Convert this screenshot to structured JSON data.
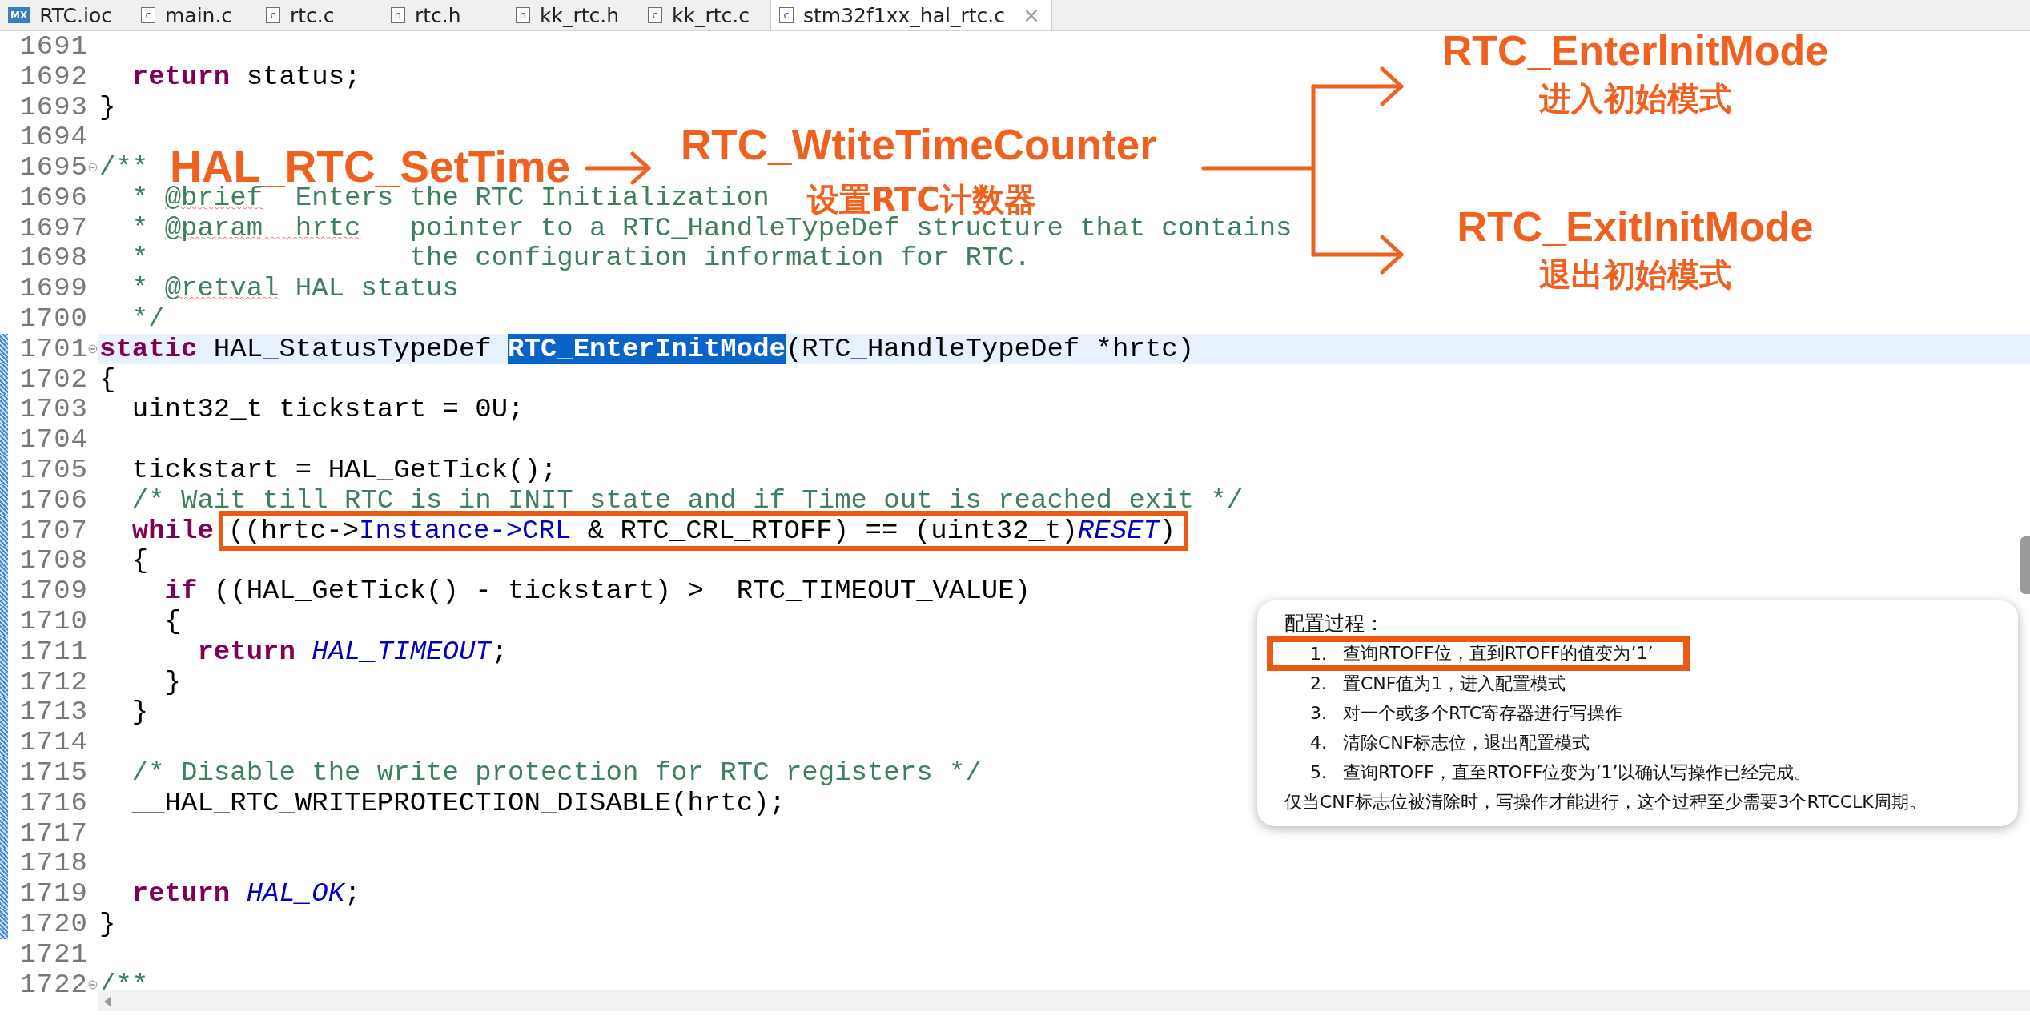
{
  "tabs": [
    {
      "label": "RTC.ioc",
      "icon": "MX",
      "kind": "mx",
      "selected": false
    },
    {
      "label": "main.c",
      "icon": "c",
      "kind": "file",
      "selected": false
    },
    {
      "label": "rtc.c",
      "icon": "c",
      "kind": "file",
      "selected": false
    },
    {
      "label": "rtc.h",
      "icon": "h",
      "kind": "file",
      "selected": false
    },
    {
      "label": "kk_rtc.h",
      "icon": "h",
      "kind": "file",
      "selected": false
    },
    {
      "label": "kk_rtc.c",
      "icon": "c",
      "kind": "file",
      "selected": false
    },
    {
      "label": "stm32f1xx_hal_rtc.c",
      "icon": "c",
      "kind": "file",
      "selected": true,
      "close": "×"
    }
  ],
  "lines": [
    {
      "number": "1691",
      "fold": false,
      "current": false,
      "changed": false
    },
    {
      "number": "1692",
      "fold": false,
      "current": false,
      "changed": false,
      "segments": [
        {
          "text": "  return",
          "kind": "keyword"
        },
        {
          "text": " status;",
          "kind": "plain"
        }
      ]
    },
    {
      "number": "1693",
      "fold": false,
      "current": false,
      "changed": false,
      "segments": [
        {
          "text": "}",
          "kind": "plain"
        }
      ]
    },
    {
      "number": "1694",
      "fold": false,
      "current": false,
      "changed": false
    },
    {
      "number": "1695",
      "fold": true,
      "current": false,
      "changed": false,
      "segments": [
        {
          "text": "/**",
          "kind": "comment"
        }
      ]
    },
    {
      "number": "1696",
      "fold": false,
      "current": false,
      "changed": false,
      "segments": [
        {
          "text": "  * ",
          "kind": "comment"
        },
        {
          "text": "@brief",
          "kind": "spelling"
        },
        {
          "text": "  Enters the RTC Initialization",
          "kind": "comment"
        }
      ]
    },
    {
      "number": "1697",
      "fold": false,
      "current": false,
      "changed": false,
      "segments": [
        {
          "text": "  * ",
          "kind": "comment"
        },
        {
          "text": "@param",
          "kind": "spelling"
        },
        {
          "text": "  hrtc",
          "kind": "spelling"
        },
        {
          "text": "   pointer to a RTC_HandleTypeDef structure that contains",
          "kind": "comment"
        }
      ]
    },
    {
      "number": "1698",
      "fold": false,
      "current": false,
      "changed": false,
      "segments": [
        {
          "text": "  *                the configuration information for RTC.",
          "kind": "comment"
        }
      ]
    },
    {
      "number": "1699",
      "fold": false,
      "current": false,
      "changed": false,
      "segments": [
        {
          "text": "  * ",
          "kind": "comment"
        },
        {
          "text": "@retval",
          "kind": "spelling"
        },
        {
          "text": " HAL status",
          "kind": "comment"
        }
      ]
    },
    {
      "number": "1700",
      "fold": false,
      "current": false,
      "changed": false,
      "segments": [
        {
          "text": "  */",
          "kind": "comment"
        }
      ]
    },
    {
      "number": "1701",
      "fold": true,
      "current": true,
      "changed": true,
      "segments": [
        {
          "text": "static",
          "kind": "keyword"
        },
        {
          "text": " HAL_StatusTypeDef ",
          "kind": "plain"
        },
        {
          "text": "RTC_EnterInitMode",
          "kind": "selected"
        },
        {
          "text": "(RTC_HandleTypeDef *hrtc)",
          "kind": "plain"
        }
      ]
    },
    {
      "number": "1702",
      "fold": false,
      "current": false,
      "changed": true,
      "segments": [
        {
          "text": "{",
          "kind": "plain"
        }
      ]
    },
    {
      "number": "1703",
      "fold": false,
      "current": false,
      "changed": true,
      "segments": [
        {
          "text": "  uint32_t tickstart = 0U;",
          "kind": "plain"
        }
      ]
    },
    {
      "number": "1704",
      "fold": false,
      "current": false,
      "changed": true
    },
    {
      "number": "1705",
      "fold": false,
      "current": false,
      "changed": true,
      "segments": [
        {
          "text": "  tickstart = HAL_GetTick();",
          "kind": "plain"
        }
      ]
    },
    {
      "number": "1706",
      "fold": false,
      "current": false,
      "changed": true,
      "segments": [
        {
          "text": "  /* Wait till RTC is in INIT state and if Time out is reached exit */",
          "kind": "comment"
        }
      ]
    },
    {
      "number": "1707",
      "fold": false,
      "current": false,
      "changed": true,
      "segments": [
        {
          "text": "  while",
          "kind": "keyword"
        }
      ],
      "outlined_segments": [
        {
          "text": "((hrtc->",
          "kind": "plain"
        },
        {
          "text": "Instance->CRL",
          "kind": "field"
        },
        {
          "text": " & RTC_CRL_RTOFF) == (uint32_t)",
          "kind": "plain"
        },
        {
          "text": "RESET",
          "kind": "constant"
        },
        {
          "text": ")",
          "kind": "plain"
        }
      ]
    },
    {
      "number": "1708",
      "fold": false,
      "current": false,
      "changed": true,
      "segments": [
        {
          "text": "  {",
          "kind": "plain"
        }
      ]
    },
    {
      "number": "1709",
      "fold": false,
      "current": false,
      "changed": true,
      "segments": [
        {
          "text": "    if",
          "kind": "keyword"
        },
        {
          "text": " ((HAL_GetTick() - tickstart) >  RTC_TIMEOUT_VALUE)",
          "kind": "plain"
        }
      ]
    },
    {
      "number": "1710",
      "fold": false,
      "current": false,
      "changed": true,
      "segments": [
        {
          "text": "    {",
          "kind": "plain"
        }
      ]
    },
    {
      "number": "1711",
      "fold": false,
      "current": false,
      "changed": true,
      "segments": [
        {
          "text": "      return",
          "kind": "keyword"
        },
        {
          "text": " HAL_TIMEOUT",
          "kind": "constant"
        },
        {
          "text": ";",
          "kind": "plain"
        }
      ]
    },
    {
      "number": "1712",
      "fold": false,
      "current": false,
      "changed": true,
      "segments": [
        {
          "text": "    }",
          "kind": "plain"
        }
      ]
    },
    {
      "number": "1713",
      "fold": false,
      "current": false,
      "changed": true,
      "segments": [
        {
          "text": "  }",
          "kind": "plain"
        }
      ]
    },
    {
      "number": "1714",
      "fold": false,
      "current": false,
      "changed": true
    },
    {
      "number": "1715",
      "fold": false,
      "current": false,
      "changed": true,
      "segments": [
        {
          "text": "  /* Disable the write protection for RTC registers */",
          "kind": "comment"
        }
      ]
    },
    {
      "number": "1716",
      "fold": false,
      "current": false,
      "changed": true,
      "segments": [
        {
          "text": "  __HAL_RTC_WRITEPROTECTION_DISABLE(hrtc);",
          "kind": "plain"
        }
      ]
    },
    {
      "number": "1717",
      "fold": false,
      "current": false,
      "changed": true
    },
    {
      "number": "1718",
      "fold": false,
      "current": false,
      "changed": true
    },
    {
      "number": "1719",
      "fold": false,
      "current": false,
      "changed": true,
      "segments": [
        {
          "text": "  return",
          "kind": "keyword"
        },
        {
          "text": " HAL_OK",
          "kind": "constant"
        },
        {
          "text": ";",
          "kind": "plain"
        }
      ]
    },
    {
      "number": "1720",
      "fold": false,
      "current": false,
      "changed": true,
      "segments": [
        {
          "text": "}",
          "kind": "plain"
        }
      ]
    },
    {
      "number": "1721",
      "fold": false,
      "current": false,
      "changed": false
    },
    {
      "number": "1722",
      "fold": true,
      "current": false,
      "changed": false,
      "segments": [
        {
          "text": "/**",
          "kind": "comment"
        }
      ]
    }
  ],
  "annotations": {
    "caller": "HAL_RTC_SetTime",
    "callee": "RTC_WtiteTimeCounter",
    "callee_note": "设置RTC计数器",
    "branches": [
      {
        "name": "RTC_EnterlnitMode",
        "note": "进入初始模式"
      },
      {
        "name": "RTC_ExitInitMode",
        "note": "退出初始模式"
      }
    ]
  },
  "popup": {
    "title": "配置过程：",
    "steps": [
      {
        "number": "1.",
        "text": "查询RTOFF位，直到RTOFF的值变为’1’",
        "outlined": true
      },
      {
        "number": "2.",
        "text": "置CNF值为1，进入配置模式",
        "outlined": false
      },
      {
        "number": "3.",
        "text": "对一个或多个RTC寄存器进行写操作",
        "outlined": false
      },
      {
        "number": "4.",
        "text": "清除CNF标志位，退出配置模式",
        "outlined": false
      },
      {
        "number": "5.",
        "text": "查询RTOFF，直至RTOFF位变为’1’以确认写操作已经完成。",
        "outlined": false
      }
    ],
    "note": "仅当CNF标志位被清除时，写操作才能进行，这个过程至少需要3个RTCCLK周期。"
  }
}
